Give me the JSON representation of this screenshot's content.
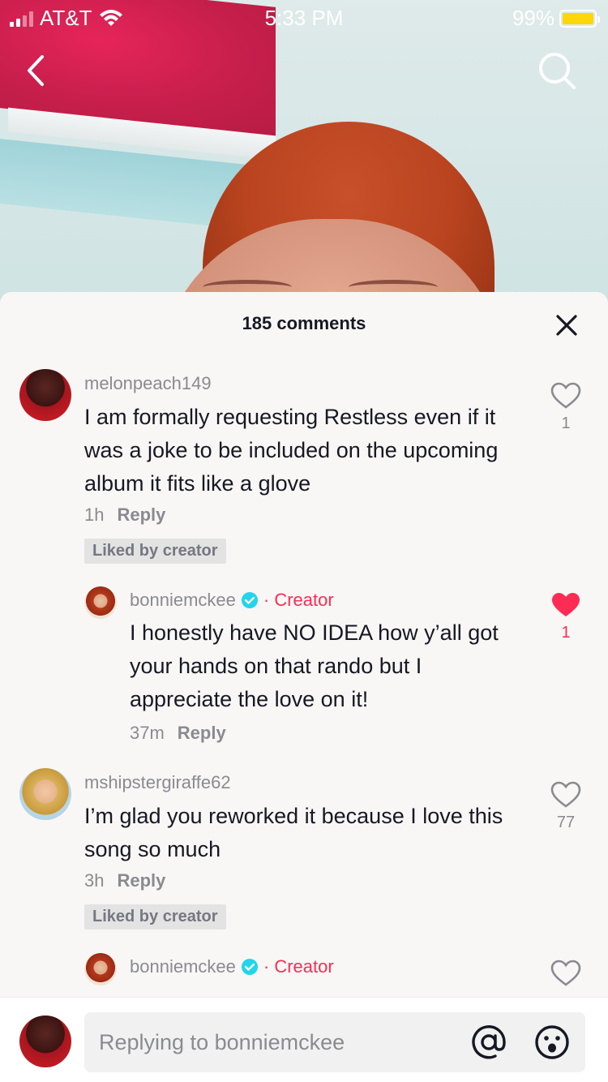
{
  "status_bar": {
    "carrier": "AT&T",
    "time": "5:33 PM",
    "battery": "99%",
    "battery_level": 0.99,
    "battery_color": "#ffd60a"
  },
  "sheet": {
    "title": "185 comments"
  },
  "comments": [
    {
      "username": "melonpeach149",
      "text": "I am formally requesting Restless even if it was a joke to be included on the upcoming album it fits like a glove",
      "time": "1h",
      "reply_label": "Reply",
      "liked_badge": "Liked by creator",
      "likes": "1",
      "liked": false
    },
    {
      "username": "bonniemckee",
      "creator_label": "· Creator",
      "text": "I honestly have NO IDEA how y’all got your hands on that rando but I appreciate the love on it!",
      "time": "37m",
      "reply_label": "Reply",
      "likes": "1",
      "liked": true
    },
    {
      "username": "mshipstergiraffe62",
      "text": "I’m glad you reworked it because I love this song so much",
      "time": "3h",
      "reply_label": "Reply",
      "liked_badge": "Liked by creator",
      "likes": "77",
      "liked": false
    },
    {
      "username": "bonniemckee",
      "creator_label": "· Creator",
      "liked": false
    }
  ],
  "input": {
    "placeholder": "Replying to bonniemckee"
  },
  "colors": {
    "accent": "#fe2c55",
    "verified": "#20d5ec",
    "text": "#161823",
    "muted": "#8a8b91"
  }
}
